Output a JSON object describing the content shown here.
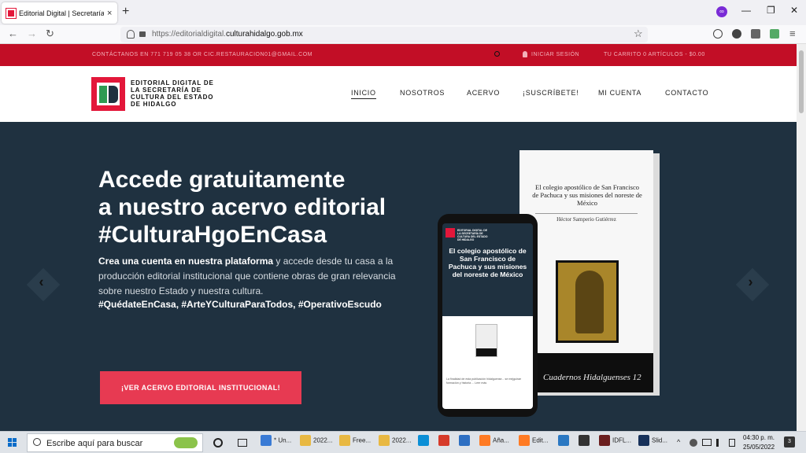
{
  "browser": {
    "tab_title": "Editorial Digital | Secretaría de",
    "tab_close": "×",
    "new_tab": "+",
    "url_prefix": "https://editorialdigital.",
    "url_domain": "culturahidalgo.gob.mx",
    "controls": {
      "minimize": "—",
      "restore": "❐",
      "close": "✕"
    },
    "nav": {
      "back": "←",
      "forward": "→",
      "reload": "↻",
      "star": "☆",
      "menu": "≡"
    }
  },
  "topbar": {
    "contact": "CONTÁCTANOS EN 771 719 05 38 OR CIC.RESTAURACION01@GMAIL.COM",
    "login": "INICIAR SESIÓN",
    "cart": "TU CARRITO 0 ARTÍCULOS - $0.00"
  },
  "header": {
    "logo_text": "EDITORIAL DIGITAL DE LA SECRETARÍA DE CULTURA DEL ESTADO DE HIDALGO",
    "menu": [
      "INICIO",
      "NOSOTROS",
      "ACERVO",
      "¡SUSCRÍBETE!",
      "MI CUENTA",
      "CONTACTO"
    ]
  },
  "hero": {
    "headline_1": "Accede gratuitamente",
    "headline_2": "a nuestro acervo editorial",
    "headline_3": "#CulturaHgoEnCasa",
    "body_bold": "Crea una cuenta en nuestra plataforma",
    "body_rest": " y accede desde tu casa a la producción editorial institucional que contiene obras de gran relevancia sobre nuestro Estado y nuestra cultura.",
    "hashtags": "#QuédateEnCasa, #ArteYCulturaParaTodos, #OperativoEscudo",
    "cta": "¡VER ACERVO EDITORIAL INSTITUCIONAL!",
    "prev": "‹",
    "next": "›",
    "book_title": "El colegio apostólico de San Francisco de Pachuca y sus misiones del noreste de México",
    "book_author": "Héctor Samperio Gutiérrez",
    "book_series": "Cuadernos Hidalguenses",
    "book_number": "12",
    "phone_logo_text": "EDITORIAL DIGITAL DE LA SECRETARÍA DE CULTURA DEL ESTADO DE HIDALGO",
    "phone_title": "El colegio apostólico de San Francisco de Pachuca y sus misiones del noreste de México",
    "phone_body": "La finalidad de esta publicación hidalguense... se mejguirae formación y historia ... Leer más"
  },
  "taskbar": {
    "search_placeholder": "Escribe aquí para buscar",
    "apps": [
      {
        "label": "* Un...",
        "color": "#3a7bd5"
      },
      {
        "label": "2022...",
        "color": "#e8b842"
      },
      {
        "label": "Free...",
        "color": "#e8b842"
      },
      {
        "label": "2022...",
        "color": "#e8b842"
      },
      {
        "label": "",
        "color": "#0b8fd6"
      },
      {
        "label": "",
        "color": "#d63b2a"
      },
      {
        "label": "",
        "color": "#2d6fc2"
      },
      {
        "label": "Aña...",
        "color": "#ff7b24"
      },
      {
        "label": "Edit...",
        "color": "#ff7b24"
      },
      {
        "label": "",
        "color": "#2b78c2"
      },
      {
        "label": "",
        "color": "#333333"
      },
      {
        "label": "IDFL...",
        "color": "#6b1f1f"
      },
      {
        "label": "Slid...",
        "color": "#17315a"
      }
    ],
    "time": "04:30 p. m.",
    "date": "25/05/2022",
    "notif_count": "3"
  }
}
